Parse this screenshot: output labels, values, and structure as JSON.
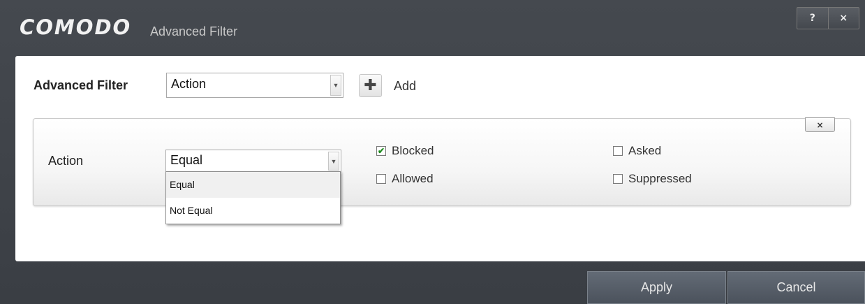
{
  "window": {
    "logo": "COMODO",
    "title": "Advanced Filter",
    "help_label": "?",
    "close_label": "×"
  },
  "filter": {
    "label": "Advanced Filter",
    "selected": "Action",
    "add_label": "Add"
  },
  "condition": {
    "label": "Action",
    "operator_selected": "Equal",
    "operator_options": [
      "Equal",
      "Not Equal"
    ],
    "remove_label": "×",
    "checkboxes": [
      {
        "label": "Blocked",
        "checked": true
      },
      {
        "label": "Allowed",
        "checked": false
      },
      {
        "label": "Asked",
        "checked": false
      },
      {
        "label": "Suppressed",
        "checked": false
      }
    ]
  },
  "footer": {
    "apply_label": "Apply",
    "cancel_label": "Cancel"
  },
  "colors": {
    "chrome": "#3d4147",
    "button": "#59616b",
    "check": "#1b8a1b"
  }
}
